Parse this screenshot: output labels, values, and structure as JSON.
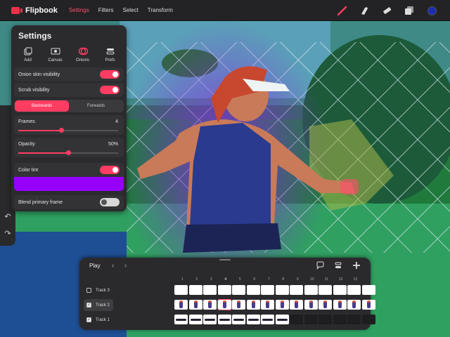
{
  "app": {
    "name": "Flipbook"
  },
  "menu": [
    "Settings",
    "Filters",
    "Select",
    "Transform"
  ],
  "icons": {
    "undo": "↶",
    "redo": "↷",
    "chevron_left": "‹",
    "chevron_right": "›"
  },
  "colors": {
    "accent": "#ff3d62",
    "tint": "#9500ff",
    "current_color": "#1a2fb0"
  },
  "settings": {
    "title": "Settings",
    "tabs": [
      "Add",
      "Canvas",
      "Onions",
      "Prefs"
    ],
    "active_tab": "Onions",
    "onion_skin_visibility": "Onion skin visibility",
    "onion_skin_visibility_on": true,
    "scrub_visibility": "Scrub visibility",
    "scrub_visibility_on": true,
    "direction": [
      "Backwards",
      "Forwards"
    ],
    "direction_selected": "Backwards",
    "frames": {
      "label": "Frames",
      "value": "4",
      "fraction": 0.43
    },
    "opacity": {
      "label": "Opacity",
      "value": "50%",
      "fraction": 0.5
    },
    "color_tint": "Color tint",
    "color_tint_on": true,
    "blend_primary_frame": "Blend primary frame",
    "blend_primary_frame_on": false
  },
  "timeline": {
    "play": "Play",
    "frame_numbers": [
      "1",
      "2",
      "3",
      "4",
      "5",
      "6",
      "7",
      "8",
      "9",
      "10",
      "11",
      "12",
      "13"
    ],
    "current_frame": "4",
    "tracks": [
      {
        "name": "Track 3",
        "checked": false,
        "selected": false,
        "cells": "blank",
        "filled": 14
      },
      {
        "name": "Track 2",
        "checked": true,
        "selected": true,
        "cells": "figure",
        "filled": 14
      },
      {
        "name": "Track 1",
        "checked": true,
        "selected": false,
        "cells": "stroke",
        "filled": 8
      }
    ]
  }
}
